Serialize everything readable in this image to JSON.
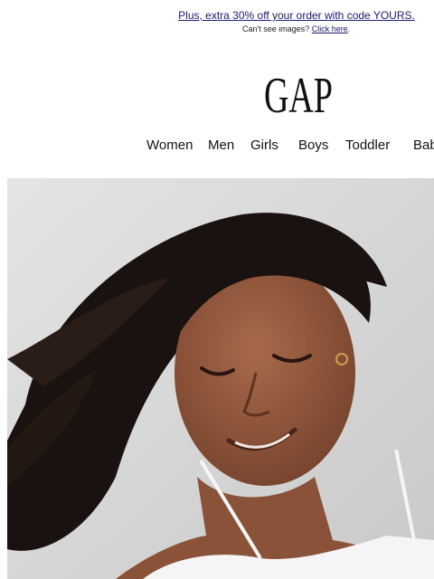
{
  "promo": {
    "text": "Plus, extra 30% off your order with code YOURS.",
    "cant_see_prefix": "Can't see images? ",
    "click_here": "Click here",
    "suffix": "."
  },
  "brand": {
    "logo_text": "GAP"
  },
  "nav": {
    "items": [
      "Women",
      "Men",
      "Girls",
      "Boys",
      "Toddler",
      "Bab"
    ]
  },
  "hero": {
    "alt": "Smiling woman with flowing dark hair in white lace camisole"
  },
  "colors": {
    "link": "#1a1a6e",
    "background": "#ffffff",
    "hero_bg": "#d7d7d7"
  }
}
